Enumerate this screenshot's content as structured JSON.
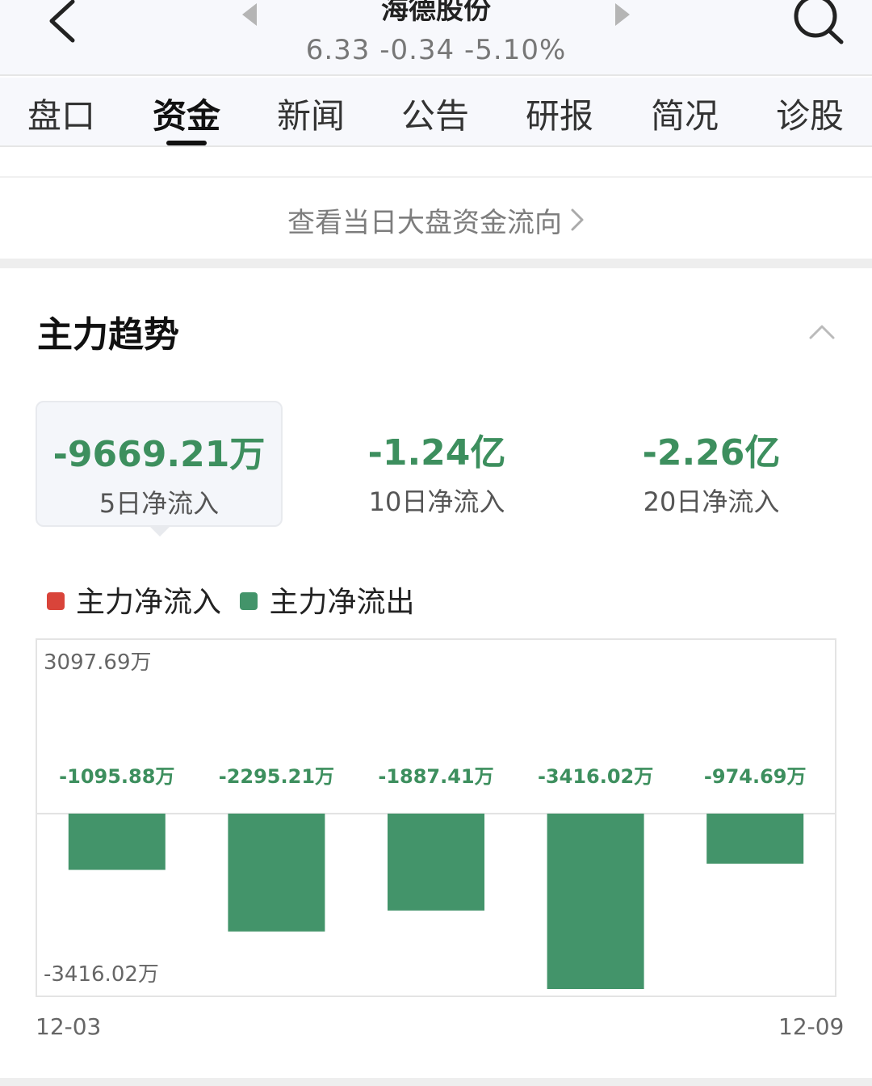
{
  "header": {
    "stock_name": "海德股份",
    "quote": "6.33 -0.34 -5.10%",
    "back_icon": "chevron-left-icon",
    "search_icon": "search-icon"
  },
  "tabs": [
    {
      "label": "盘口"
    },
    {
      "label": "资金",
      "active": true
    },
    {
      "label": "新闻"
    },
    {
      "label": "公告"
    },
    {
      "label": "研报"
    },
    {
      "label": "简况"
    },
    {
      "label": "诊股"
    }
  ],
  "market_link": {
    "label": "查看当日大盘资金流向",
    "icon": "chevron-right-icon"
  },
  "section": {
    "title": "主力趋势",
    "collapse_icon": "chevron-up-icon"
  },
  "metrics": [
    {
      "value": "-9669.21万",
      "label": "5日净流入",
      "active": true
    },
    {
      "value": "-1.24亿",
      "label": "10日净流入"
    },
    {
      "value": "-2.26亿",
      "label": "20日净流入"
    }
  ],
  "legend": [
    {
      "label": "主力净流入",
      "color": "#d9443a"
    },
    {
      "label": "主力净流出",
      "color": "#43946a"
    }
  ],
  "colors": {
    "negative": "#43946a",
    "positive": "#d9443a",
    "value_text": "#3d8f5e"
  },
  "chart_data": {
    "type": "bar",
    "categories": [
      "12-03",
      "",
      "",
      "",
      "12-09"
    ],
    "values": [
      -1095.88,
      -2295.21,
      -1887.41,
      -3416.02,
      -974.69
    ],
    "value_labels": [
      "-1095.88万",
      "-2295.21万",
      "-1887.41万",
      "-3416.02万",
      "-974.69万"
    ],
    "ylim": [
      -3416.02,
      3097.69
    ],
    "ymax_label": "3097.69万",
    "ymin_label": "-3416.02万",
    "x_start_label": "12-03",
    "x_end_label": "12-09"
  }
}
